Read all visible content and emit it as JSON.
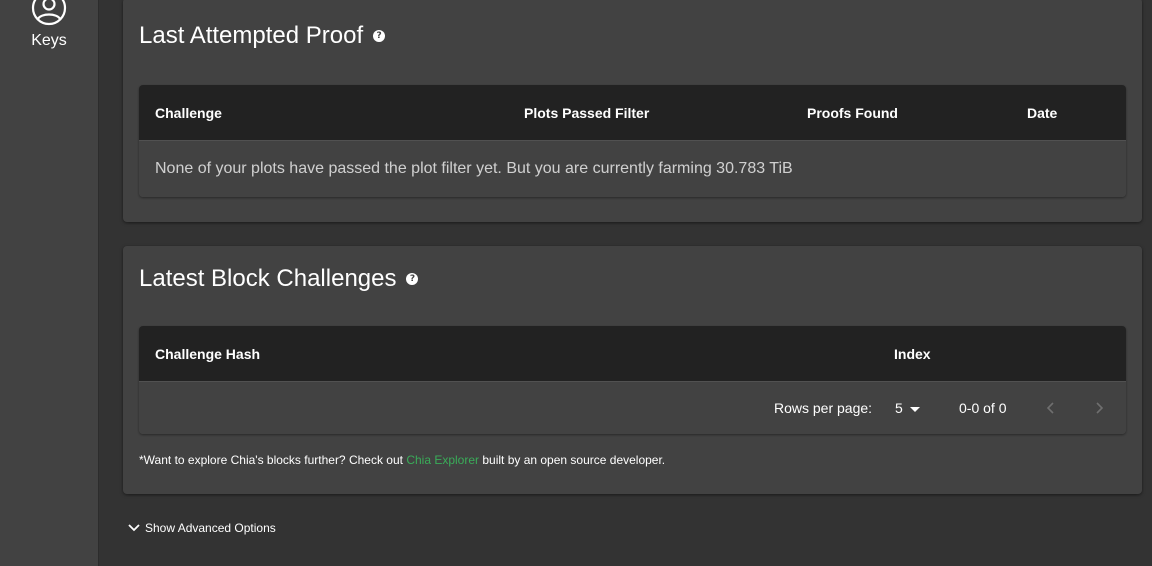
{
  "sidebar": {
    "keys_label": "Keys"
  },
  "last_attempted_proof": {
    "title": "Last Attempted Proof",
    "help_glyph": "?",
    "columns": [
      "Challenge",
      "Plots Passed Filter",
      "Proofs Found",
      "Date"
    ],
    "empty_message": "None of your plots have passed the plot filter yet. But you are currently farming 30.783 TiB"
  },
  "latest_block_challenges": {
    "title": "Latest Block Challenges",
    "help_glyph": "?",
    "columns": [
      "Challenge Hash",
      "Index"
    ],
    "pagination": {
      "rows_per_page_label": "Rows per page:",
      "rows_per_page_value": "5",
      "range": "0-0 of 0"
    },
    "footnote": {
      "prefix": "*Want to explore Chia's blocks further? Check out ",
      "link": "Chia Explorer",
      "suffix": " built by an open source developer."
    }
  },
  "advanced_options_label": "Show Advanced Options",
  "colors": {
    "background": "#333333",
    "card": "#424242",
    "table_header": "#222222",
    "link": "#3aac59"
  }
}
